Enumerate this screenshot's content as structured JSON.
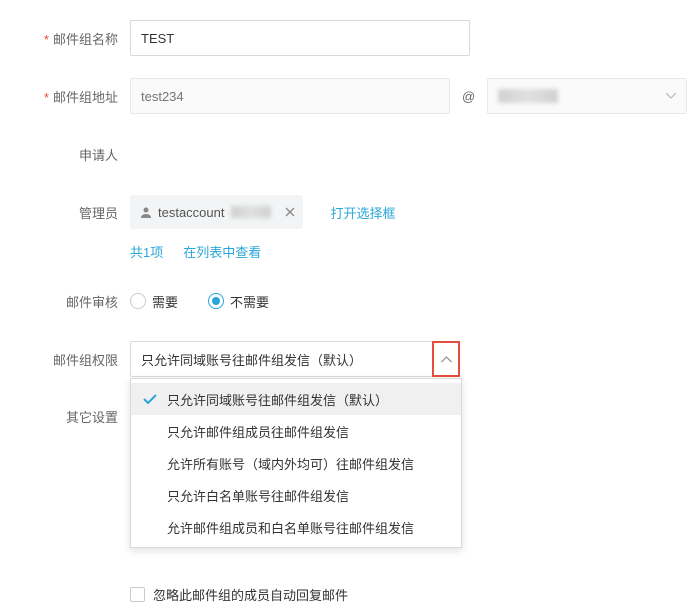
{
  "labels": {
    "group_name": "邮件组名称",
    "group_addr": "邮件组地址",
    "applicant": "申请人",
    "admin": "管理员",
    "review": "邮件审核",
    "permission": "邮件组权限",
    "other": "其它设置"
  },
  "inputs": {
    "name_value": "TEST",
    "addr_placeholder": "test234"
  },
  "at": "@",
  "admin_chip": {
    "text_prefix": "testaccount"
  },
  "links": {
    "open_selector": "打开选择框",
    "total": "共1项",
    "view_list": "在列表中查看"
  },
  "review_options": {
    "yes": "需要",
    "no": "不需要"
  },
  "permission_select": {
    "value": "只允许同域账号往邮件组发信（默认）",
    "options": [
      "只允许同域账号往邮件组发信（默认）",
      "只允许邮件组成员往邮件组发信",
      "允许所有账号（域内外均可）往邮件组发信",
      "只允许白名单账号往邮件组发信",
      "允许邮件组成员和白名单账号往邮件组发信"
    ]
  },
  "other_checkbox": {
    "label": "忽略此邮件组的成员自动回复邮件"
  }
}
